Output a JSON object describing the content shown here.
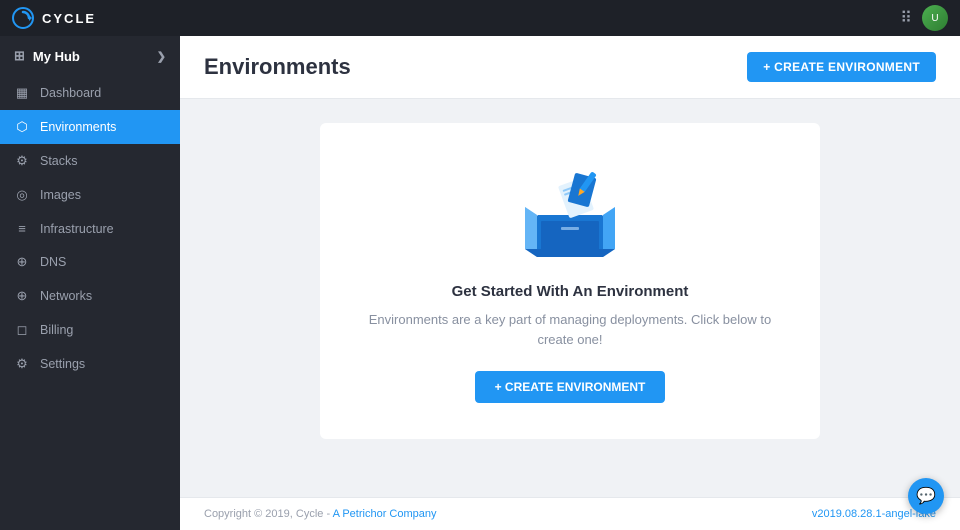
{
  "app": {
    "name": "CYCLE"
  },
  "topbar": {
    "logo_text": "CYCLE",
    "menu_icon": "☰",
    "avatar_initials": "U"
  },
  "sidebar": {
    "hub_label": "My Hub",
    "items": [
      {
        "id": "dashboard",
        "label": "Dashboard",
        "icon": "⊞",
        "active": false
      },
      {
        "id": "environments",
        "label": "Environments",
        "icon": "⬡",
        "active": true
      },
      {
        "id": "stacks",
        "label": "Stacks",
        "icon": "⚙",
        "active": false
      },
      {
        "id": "images",
        "label": "Images",
        "icon": "◎",
        "active": false
      },
      {
        "id": "infrastructure",
        "label": "Infrastructure",
        "icon": "≡",
        "active": false
      },
      {
        "id": "dns",
        "label": "DNS",
        "icon": "⊕",
        "active": false
      },
      {
        "id": "networks",
        "label": "Networks",
        "icon": "⊕",
        "active": false
      },
      {
        "id": "billing",
        "label": "Billing",
        "icon": "◻",
        "active": false
      },
      {
        "id": "settings",
        "label": "Settings",
        "icon": "⚙",
        "active": false
      }
    ]
  },
  "main": {
    "title": "Environments",
    "create_button_label": "+ CREATE ENVIRONMENT"
  },
  "empty_state": {
    "title": "Get Started With An Environment",
    "description": "Environments are a key part of managing deployments. Click below to create one!",
    "create_button_label": "+ CREATE ENVIRONMENT"
  },
  "footer": {
    "copyright": "Copyright © 2019, Cycle - ",
    "company_link_text": "A Petrichor Company",
    "version": "v2019.08.28.1-angel-lake"
  }
}
